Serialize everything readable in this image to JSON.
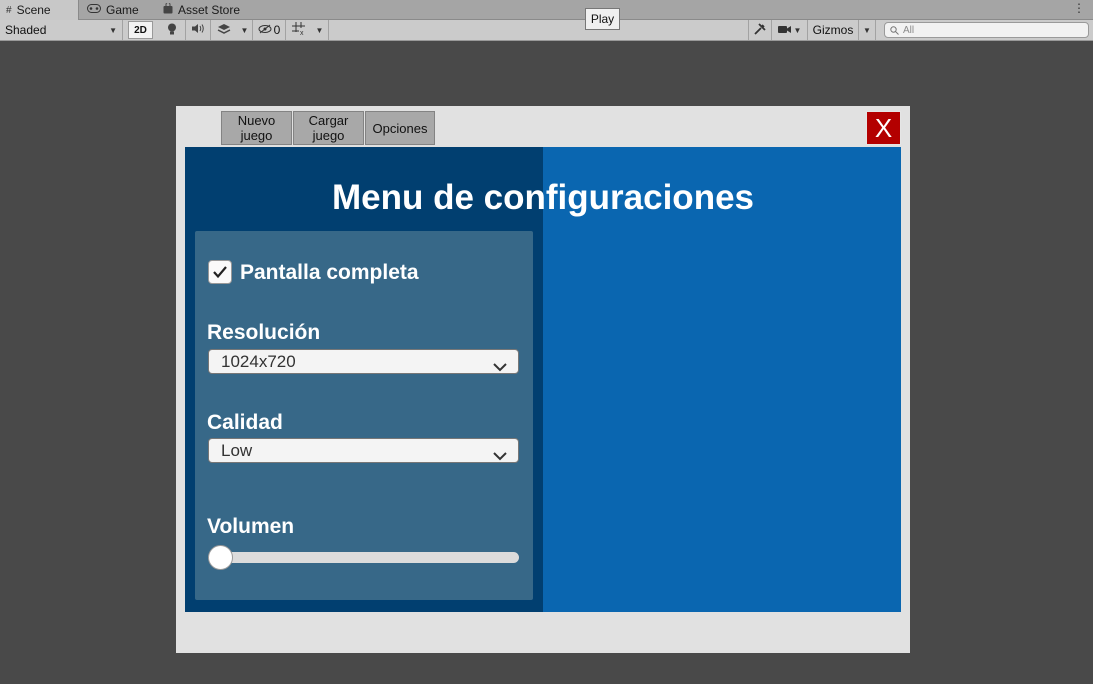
{
  "tabs": [
    {
      "label": "Scene",
      "icon": "grid-icon",
      "active": true
    },
    {
      "label": "Game",
      "icon": "gamepad-icon",
      "active": false
    },
    {
      "label": "Asset Store",
      "icon": "bag-icon",
      "active": false
    }
  ],
  "toolbar": {
    "draw_mode": "Shaded",
    "mode_2d": "2D",
    "hidden_count": "0",
    "gizmos": "Gizmos",
    "search_placeholder": "All"
  },
  "tooltip": {
    "play": "Play"
  },
  "game": {
    "buttons": {
      "nuevo": "Nuevo juego",
      "cargar": "Cargar juego",
      "opciones": "Opciones",
      "close": "X"
    },
    "title": "Menu de configuraciones",
    "fullscreen": {
      "label": "Pantalla completa",
      "checked": true
    },
    "resolution": {
      "label": "Resolución",
      "value": "1024x720"
    },
    "quality": {
      "label": "Calidad",
      "value": "Low"
    },
    "volume": {
      "label": "Volumen",
      "value": 0
    }
  },
  "colors": {
    "panel_dark": "#013f70",
    "panel_blue": "#0a66b0",
    "settings_bg": "#376888",
    "close_red": "#b30000",
    "editor_bg": "#494949"
  }
}
